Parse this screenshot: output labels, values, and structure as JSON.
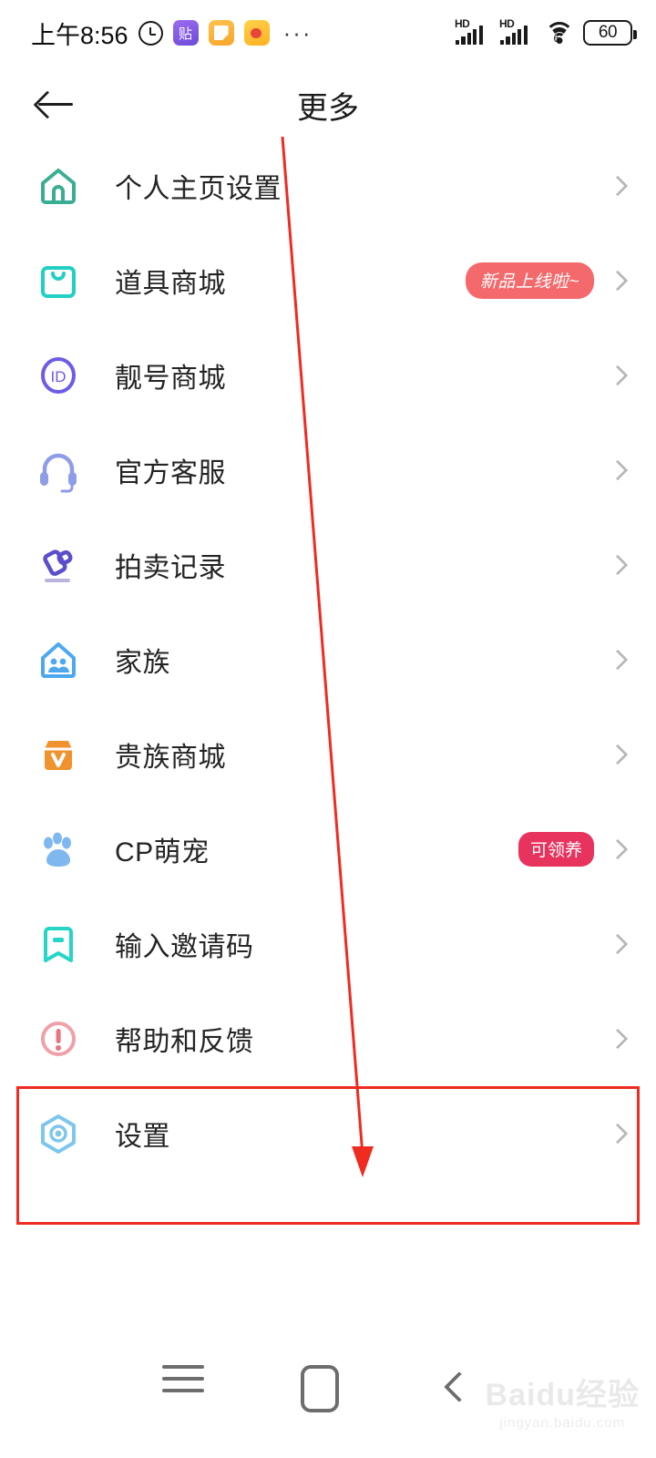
{
  "status_bar": {
    "time": "上午8:56",
    "alarm_icon": "alarm-clock-icon",
    "app_icons": [
      "tieba-icon",
      "note-icon",
      "weibo-icon"
    ],
    "overflow": "···",
    "signal_1_label": "HD",
    "signal_2_label": "HD",
    "wifi_generation": "6",
    "battery_level": "60"
  },
  "header": {
    "back_icon": "back-arrow-icon",
    "title": "更多"
  },
  "list": {
    "items": [
      {
        "label": "个人主页设置",
        "icon": "home-icon",
        "badge": null,
        "chevron": "chevron-right-icon"
      },
      {
        "label": "道具商城",
        "icon": "shopping-bag-icon",
        "badge": "新品上线啦~",
        "badge_style": "new",
        "chevron": "chevron-right-icon"
      },
      {
        "label": "靓号商城",
        "icon": "id-badge-icon",
        "badge": null,
        "chevron": "chevron-right-icon"
      },
      {
        "label": "官方客服",
        "icon": "headset-icon",
        "badge": null,
        "chevron": "chevron-right-icon"
      },
      {
        "label": "拍卖记录",
        "icon": "gavel-icon",
        "badge": null,
        "chevron": "chevron-right-icon"
      },
      {
        "label": "家族",
        "icon": "family-house-icon",
        "badge": null,
        "chevron": "chevron-right-icon"
      },
      {
        "label": "贵族商城",
        "icon": "noble-shop-icon",
        "badge": null,
        "chevron": "chevron-right-icon"
      },
      {
        "label": "CP萌宠",
        "icon": "paw-icon",
        "badge": "可领养",
        "badge_style": "pet",
        "chevron": "chevron-right-icon"
      },
      {
        "label": "输入邀请码",
        "icon": "invite-code-icon",
        "badge": null,
        "chevron": "chevron-right-icon"
      },
      {
        "label": "帮助和反馈",
        "icon": "help-circle-icon",
        "badge": null,
        "chevron": "chevron-right-icon"
      },
      {
        "label": "设置",
        "icon": "settings-hex-icon",
        "badge": null,
        "chevron": "chevron-right-icon"
      }
    ]
  },
  "annotation": {
    "highlight_target": "设置",
    "color": "#f02b20",
    "shape": "rectangle-with-arrow"
  },
  "nav_bar": {
    "menu_icon": "menu-icon",
    "home_icon": "home-square-icon",
    "back_icon": "back-chevron-icon"
  },
  "watermark": {
    "main": "Baidu经验",
    "sub": "jingyan.baidu.com"
  },
  "colors": {
    "home": "#3aae93",
    "bag": "#22cfc4",
    "id": "#6c5ce7",
    "headset": "#8f9ce8",
    "gavel": "#5b4ecb",
    "family": "#4ea8f0",
    "noble": "#f0922e",
    "paw": "#7fb8ee",
    "invite": "#25d5c8",
    "help": "#f0a0a8",
    "settings": "#7ec6ee",
    "badge_new": "#f4696b",
    "badge_pet": "#e8335e",
    "annotation": "#f02b20",
    "chevron": "#b8b8b8"
  }
}
